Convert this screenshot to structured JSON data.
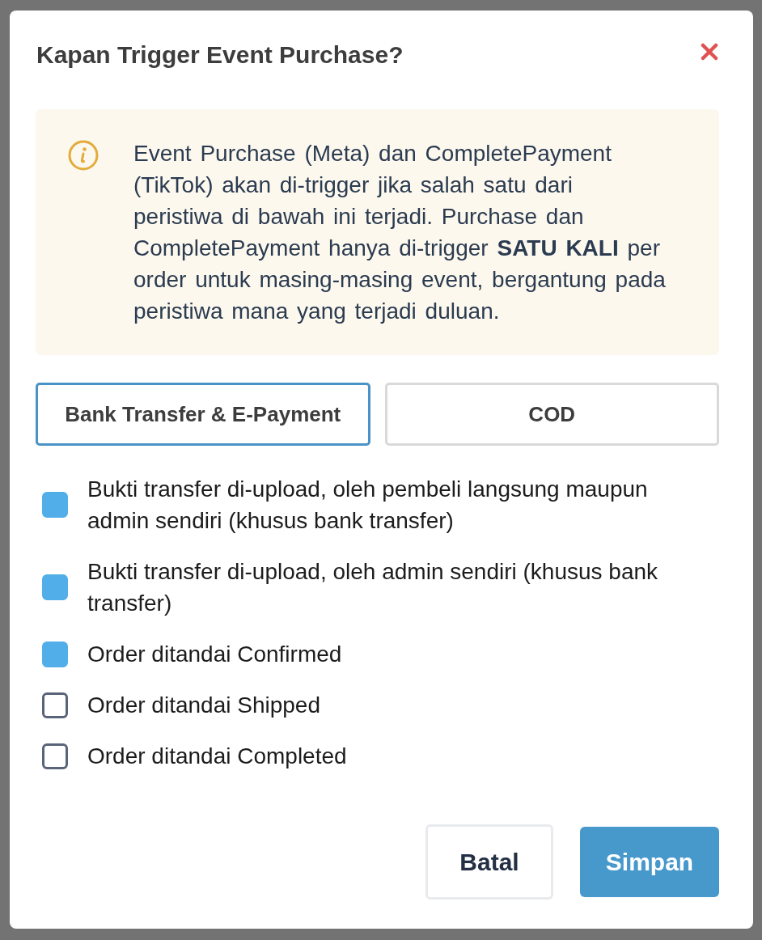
{
  "dialog": {
    "title": "Kapan Trigger Event Purchase?"
  },
  "info": {
    "text": "Event Purchase (Meta) dan CompletePayment (TikTok) akan di-trigger jika salah satu dari peristiwa di bawah ini terjadi. Purchase dan CompletePayment hanya di-trigger **SATU KALI** per order untuk masing-masing event, bergantung pada peristiwa mana yang terjadi duluan."
  },
  "tabs": [
    {
      "label": "Bank Transfer & E-Payment",
      "selected": true
    },
    {
      "label": "COD",
      "selected": false
    }
  ],
  "events": [
    {
      "label": "Bukti transfer di-upload, oleh pembeli langsung maupun admin sendiri (khusus bank transfer)",
      "checked": true
    },
    {
      "label": "Bukti transfer di-upload, oleh admin sendiri (khusus bank transfer)",
      "checked": true
    },
    {
      "label": "Order ditandai Confirmed",
      "checked": true
    },
    {
      "label": "Order ditandai Shipped",
      "checked": false
    },
    {
      "label": "Order ditandai Completed",
      "checked": false
    }
  ],
  "buttons": [
    {
      "label": "Batal",
      "kind": "secondary"
    },
    {
      "label": "Simpan",
      "kind": "primary"
    }
  ]
}
